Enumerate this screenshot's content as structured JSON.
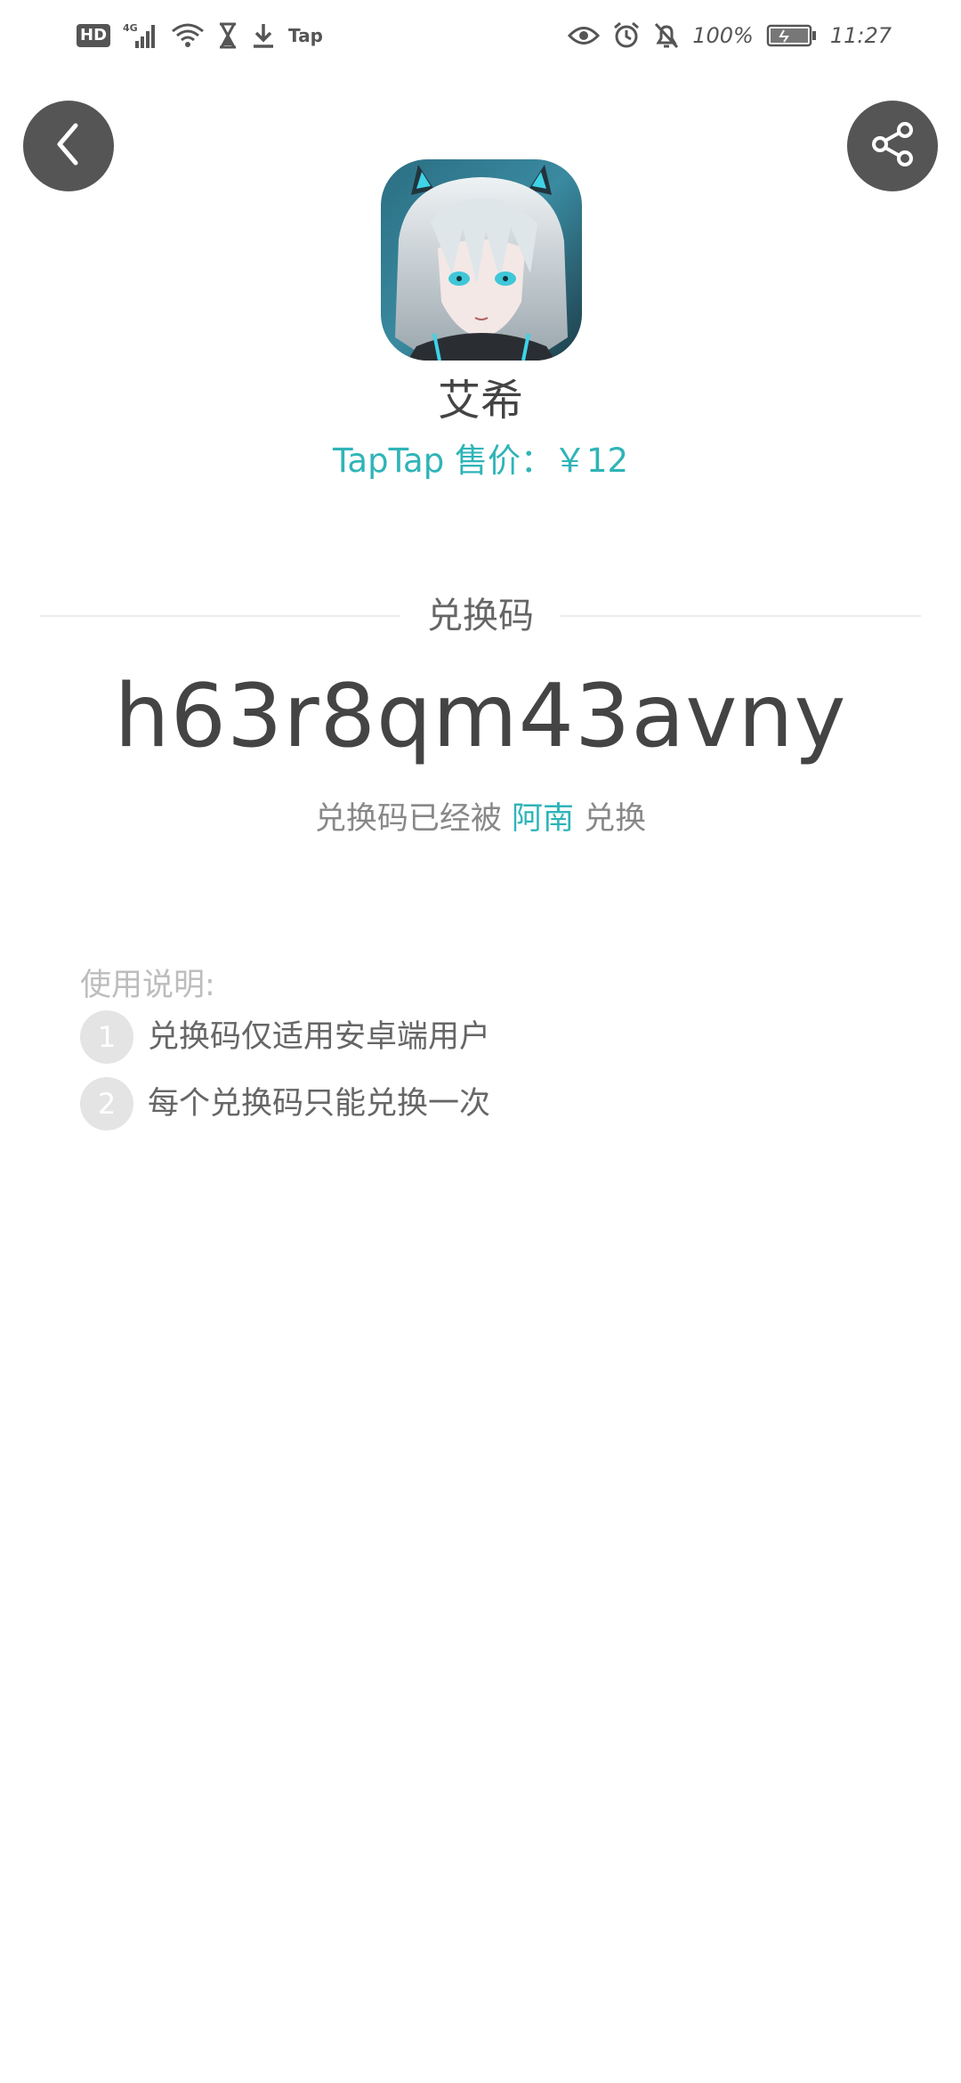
{
  "status_bar": {
    "hd": "HD",
    "network": "4G",
    "tap": "Tap",
    "battery": "100%",
    "time": "11:27",
    "icons": [
      "hd-badge",
      "signal-icon",
      "wifi-icon",
      "hourglass-icon",
      "download-icon",
      "tap-icon",
      "eye-icon",
      "alarm-icon",
      "bell-off-icon",
      "battery-icon"
    ]
  },
  "nav": {
    "back_icon": "chevron-left-icon",
    "share_icon": "share-icon"
  },
  "game": {
    "name": "艾希",
    "price": "TapTap 售价：￥12"
  },
  "code_section": {
    "label": "兑换码",
    "code": "h63r8qm43avny",
    "status_prefix": "兑换码已经被 ",
    "redeemed_by": "阿南",
    "status_suffix": " 兑换"
  },
  "instructions": {
    "title": "使用说明:",
    "items": [
      {
        "num": "1",
        "text": "兑换码仅适用安卓端用户"
      },
      {
        "num": "2",
        "text": "每个兑换码只能兑换一次"
      }
    ]
  },
  "colors": {
    "accent": "#2fb4b8",
    "button_bg": "#555555",
    "text": "#444444"
  }
}
